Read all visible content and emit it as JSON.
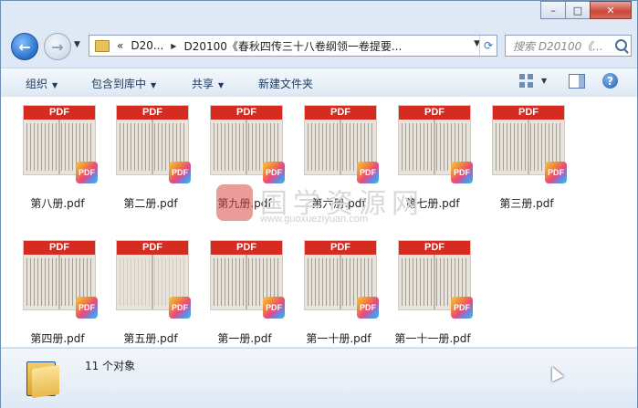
{
  "window": {
    "controls": {
      "minimize": "–",
      "maximize": "□",
      "close": "✕"
    }
  },
  "nav": {
    "back_icon": "arrow-left-icon",
    "forward_icon": "arrow-right-icon",
    "address": {
      "prefix": "«",
      "crumb1": "D20...",
      "crumb2": "D20100《春秋四传三十八卷纲领一卷提要..."
    },
    "search_placeholder": "搜索 D20100《..."
  },
  "toolbar": {
    "organize": "组织",
    "include_in_library": "包含到库中",
    "share": "共享",
    "new_folder": "新建文件夹"
  },
  "files": [
    {
      "name": "第八册.pdf"
    },
    {
      "name": "第二册.pdf"
    },
    {
      "name": "第九册.pdf"
    },
    {
      "name": "第六册.pdf"
    },
    {
      "name": "第七册.pdf"
    },
    {
      "name": "第三册.pdf"
    },
    {
      "name": "第四册.pdf"
    },
    {
      "name": "第五册.pdf"
    },
    {
      "name": "第一册.pdf"
    },
    {
      "name": "第一十册.pdf"
    },
    {
      "name": "第一十一册.pdf"
    }
  ],
  "thumb": {
    "header": "PDF",
    "badge": "PDF"
  },
  "watermark": {
    "text": "国学资源网",
    "url": "www.guoxueziyuan.com"
  },
  "status": {
    "count": "11 个对象"
  },
  "colors": {
    "pdf_red": "#d62b20",
    "window_blue": "#dfe9f5",
    "accent": "#2a6fc9"
  }
}
